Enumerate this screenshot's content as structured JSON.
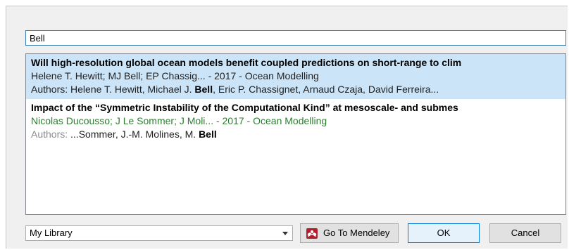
{
  "search": {
    "value": "Bell"
  },
  "results": [
    {
      "title": "Will high-resolution global ocean models benefit coupled predictions on short-range to clim",
      "meta": "Helene T. Hewitt; MJ Bell; EP Chassig... - 2017 - Ocean Modelling",
      "authors_prefix": "Authors: ",
      "authors_before": "Helene T. Hewitt, Michael J. ",
      "authors_bold": "Bell",
      "authors_after": ", Eric P. Chassignet, Arnaud Czaja, David Ferreira...",
      "selected": true
    },
    {
      "title": "Impact of the “Symmetric Instability of the Computational Kind” at mesoscale- and submes",
      "meta": "Nicolas Ducousso; J Le Sommer; J Moli... - 2017 - Ocean Modelling",
      "authors_prefix": "Authors: ",
      "authors_before": "...Sommer, J.-M. Molines, M. ",
      "authors_bold": "Bell",
      "authors_after": "",
      "selected": false
    }
  ],
  "library_select": {
    "selected": "My Library"
  },
  "buttons": {
    "mendeley": "Go To Mendeley",
    "ok": "OK",
    "cancel": "Cancel"
  },
  "icons": {
    "mendeley": "mendeley-logo-icon",
    "dropdown": "chevron-down-icon"
  },
  "colors": {
    "selection": "#cce4f7",
    "meta_green": "#2e7d32",
    "mendeley_red": "#b41e2c",
    "focus_border": "#0078d7"
  }
}
